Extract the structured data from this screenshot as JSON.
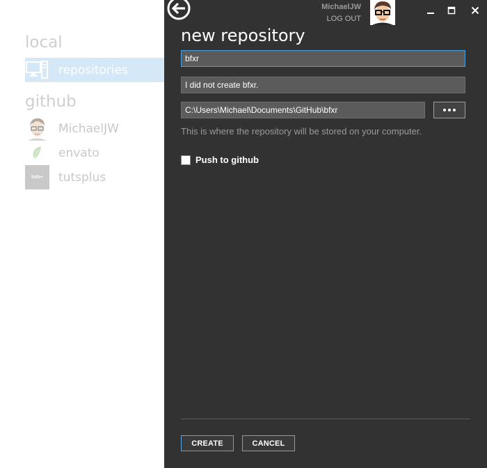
{
  "sidebar": {
    "local_title": "local",
    "github_title": "github",
    "local_items": [
      {
        "label": "repositories",
        "icon": "computer-icon"
      }
    ],
    "github_items": [
      {
        "label": "MichaelJW",
        "icon": "avatar-icon"
      },
      {
        "label": "envato",
        "icon": "leaf-icon"
      },
      {
        "label": "tutsplus",
        "icon": "tutsplus-logo",
        "logo_text": "tuts+"
      }
    ]
  },
  "header": {
    "username": "MichaelJW",
    "logout_label": "LOG OUT"
  },
  "form": {
    "title": "new repository",
    "name_value": "bfxr",
    "description_value": "I did not create bfxr.",
    "path_value": "C:\\Users\\Michael\\Documents\\GitHub\\bfxr",
    "hint": "This is where the repository will be stored on your computer.",
    "push_label": "Push to github",
    "push_checked": false
  },
  "buttons": {
    "create_label": "CREATE",
    "cancel_label": "CANCEL"
  },
  "colors": {
    "panel_bg": "#323232",
    "accent": "#4a9fdc",
    "selected_bg": "#d5e8f8"
  }
}
